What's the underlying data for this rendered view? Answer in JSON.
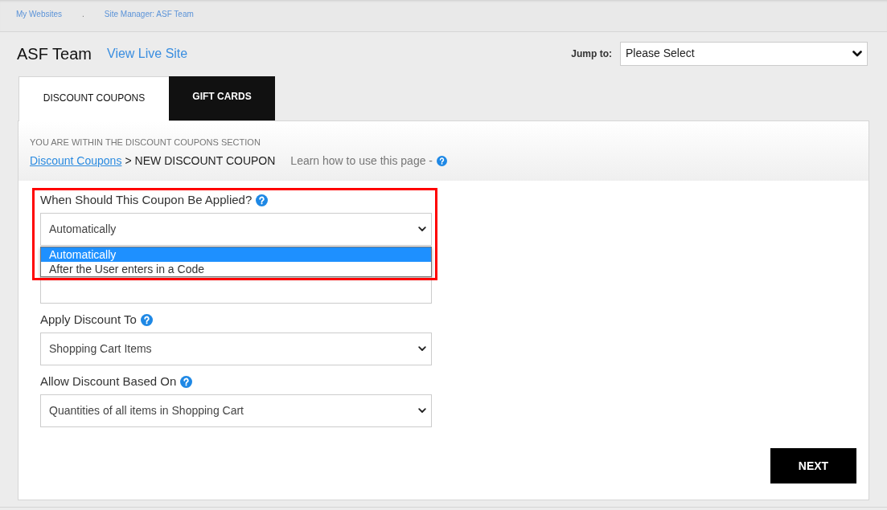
{
  "top_nav": {
    "items": [
      {
        "kind": "link",
        "label": "My Websites"
      },
      {
        "kind": "separator",
        "label": "."
      },
      {
        "kind": "link",
        "label": "Site Manager: ASF Team"
      }
    ]
  },
  "header": {
    "title": "ASF Team",
    "live_site_link": "View Live Site",
    "jump_to": {
      "label": "Jump to:",
      "value": "Please Select"
    }
  },
  "tabs": [
    {
      "label": "DISCOUNT COUPONS",
      "selected": true
    },
    {
      "label": "GIFT CARDS",
      "selected": false
    }
  ],
  "section": {
    "notice": "YOU ARE WITHIN THE DISCOUNT COUPONS SECTION",
    "breadcrumb": {
      "link": "Discount Coupons",
      "separator": ">",
      "current": "NEW DISCOUNT COUPON"
    },
    "help_text": "Learn how to use this page -"
  },
  "form": {
    "fields": [
      {
        "kind": "select",
        "label": "When Should This Coupon Be Applied?",
        "help": true,
        "value": "Automatically",
        "expanded": true,
        "highlighted": true,
        "options": [
          {
            "label": "Automatically",
            "selected": true
          },
          {
            "label": "After the User enters in a Code",
            "selected": false
          }
        ]
      },
      {
        "kind": "text"
      },
      {
        "kind": "select",
        "label": "Apply Discount To",
        "help": true,
        "value": "Shopping Cart Items"
      },
      {
        "kind": "select",
        "label": "Allow Discount Based On",
        "help": true,
        "value": "Quantities of all items in Shopping Cart"
      }
    ]
  },
  "buttons": [
    {
      "label": "NEXT"
    }
  ]
}
